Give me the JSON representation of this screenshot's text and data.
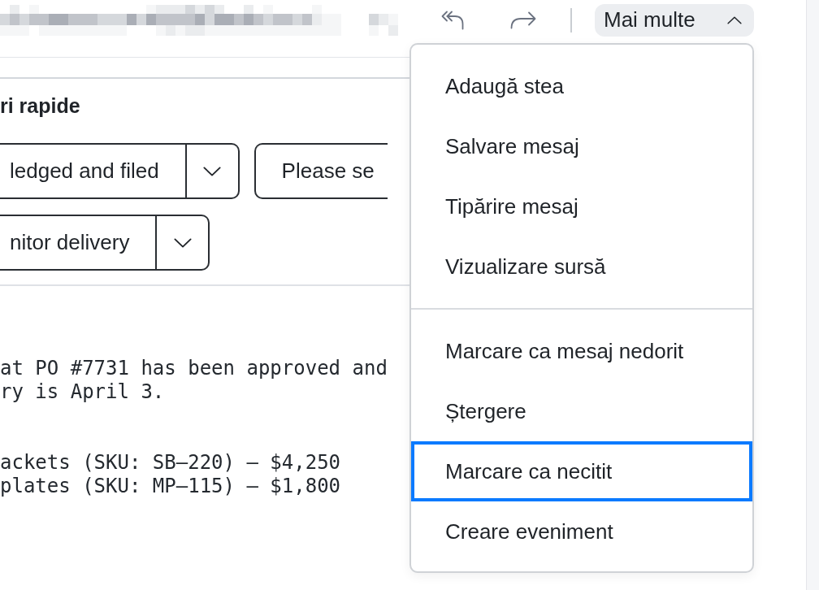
{
  "header": {
    "more_button": {
      "label": "Mai multe",
      "expanded": true
    }
  },
  "quick_replies": {
    "title": "ri rapide",
    "buttons": [
      {
        "label": "ledged and filed",
        "kind": "split"
      },
      {
        "label": "Please se",
        "kind": "plain"
      },
      {
        "label": "nitor delivery",
        "kind": "split"
      }
    ]
  },
  "message_body": {
    "paragraphs": [
      [
        "at PO #7731 has been approved and",
        "ry is April 3."
      ],
      [
        "ackets (SKU: SB–220) — $4,250",
        "plates (SKU: MP–115) — $1,800"
      ]
    ]
  },
  "menu": {
    "groups": [
      {
        "items": [
          {
            "label": "Adaugă stea",
            "highlighted": false
          },
          {
            "label": "Salvare mesaj",
            "highlighted": false
          },
          {
            "label": "Tipărire mesaj",
            "highlighted": false
          },
          {
            "label": "Vizualizare sursă",
            "highlighted": false
          }
        ]
      },
      {
        "items": [
          {
            "label": "Marcare ca mesaj nedorit",
            "highlighted": false
          },
          {
            "label": "Ștergere",
            "highlighted": false
          },
          {
            "label": "Marcare ca necitit",
            "highlighted": true
          },
          {
            "label": "Creare eveniment",
            "highlighted": false
          }
        ]
      }
    ]
  }
}
